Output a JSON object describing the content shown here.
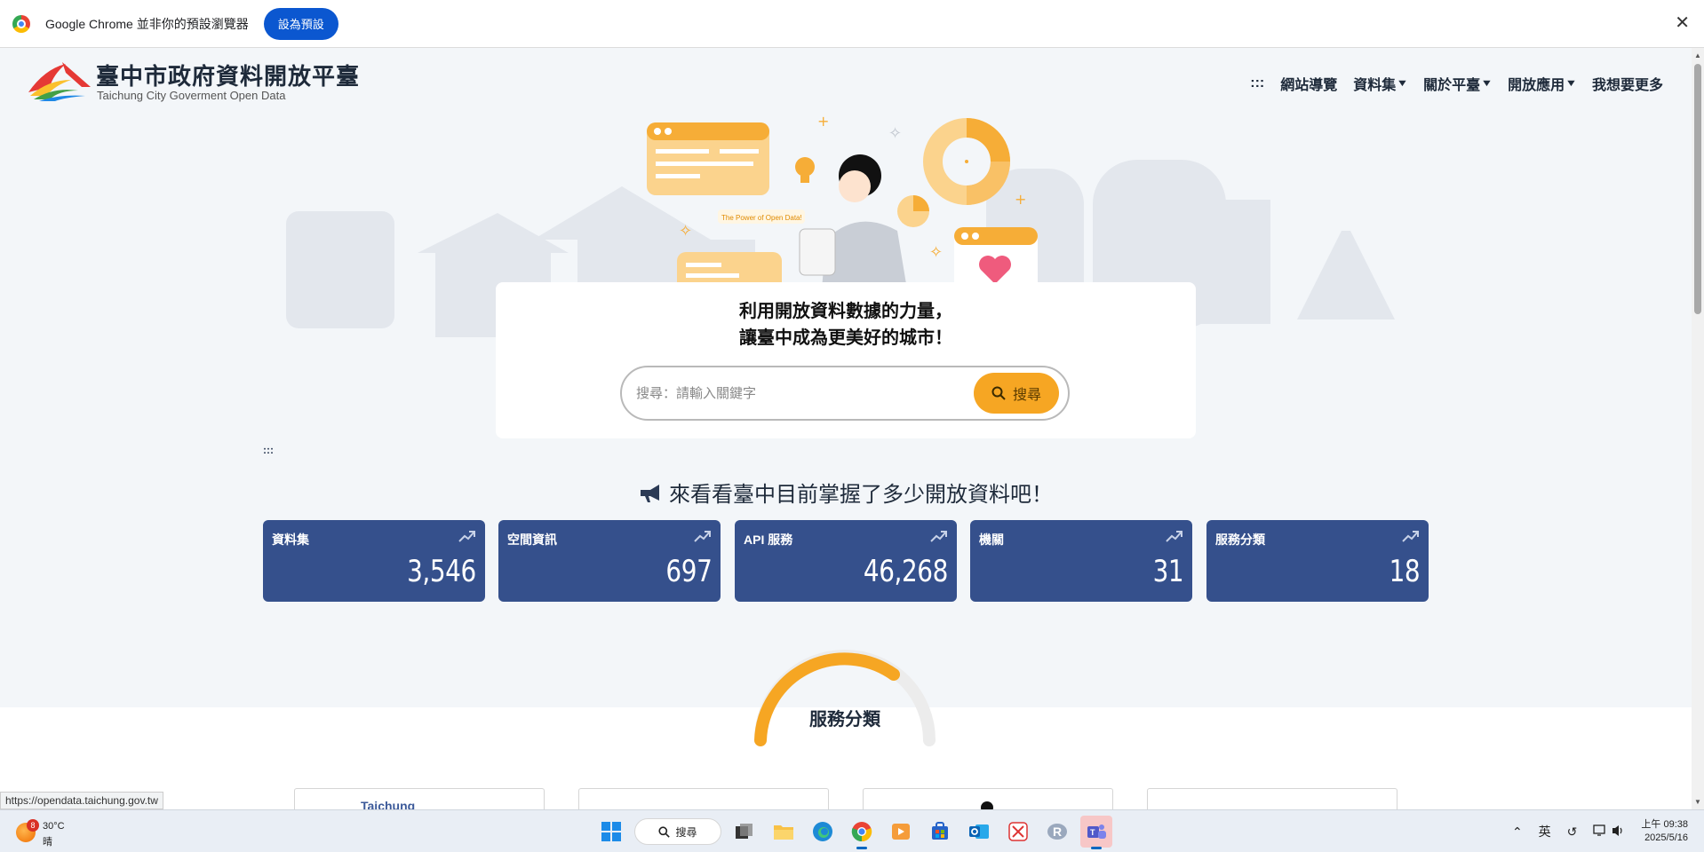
{
  "infobar": {
    "message": "Google Chrome 並非你的預設瀏覽器",
    "button": "設為預設",
    "close": "✕"
  },
  "header": {
    "title": "臺中市政府資料開放平臺",
    "subtitle": "Taichung City Goverment Open Data",
    "nav": [
      {
        "label": ":::",
        "dropdown": false
      },
      {
        "label": "網站導覽",
        "dropdown": false
      },
      {
        "label": "資料集",
        "dropdown": true
      },
      {
        "label": "關於平臺",
        "dropdown": true
      },
      {
        "label": "開放應用",
        "dropdown": true
      },
      {
        "label": "我想要更多",
        "dropdown": false
      }
    ]
  },
  "hero": {
    "illustration_text": "The Power of Open Data!",
    "slogan_line1": "利用開放資料數據的力量，",
    "slogan_line2": "讓臺中成為更美好的城市！",
    "search_placeholder": "搜尋：請輸入關鍵字",
    "search_button": "搜尋"
  },
  "skip_link": ":::",
  "stats": {
    "title": "來看看臺中目前掌握了多少開放資料吧！",
    "cards": [
      {
        "label": "資料集",
        "value": "3,546"
      },
      {
        "label": "空間資訊",
        "value": "697"
      },
      {
        "label": "API 服務",
        "value": "46,268"
      },
      {
        "label": "機關",
        "value": "31"
      },
      {
        "label": "服務分類",
        "value": "18"
      }
    ]
  },
  "categories": {
    "title": "服務分類",
    "first_card_text": "Taichung"
  },
  "status_url": "https://opendata.taichung.gov.tw",
  "taskbar": {
    "weather_badge": "8",
    "weather_temp": "30°C",
    "weather_cond": "晴",
    "search_label": "搜尋",
    "ime": "英",
    "time": "上午 09:38",
    "date": "2025/5/16"
  },
  "colors": {
    "card_bg": "#35508c",
    "accent": "#f6a623",
    "chrome_button": "#0b57d0"
  }
}
